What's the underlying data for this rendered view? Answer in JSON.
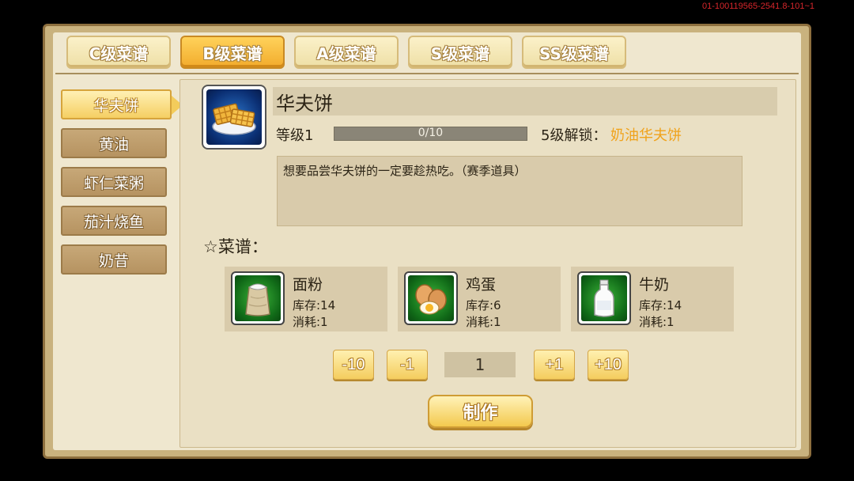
{
  "version": "01-100119565-2541.8-101~1",
  "tabs": [
    {
      "label": "C级菜谱",
      "active": false
    },
    {
      "label": "B级菜谱",
      "active": true
    },
    {
      "label": "A级菜谱",
      "active": false
    },
    {
      "label": "S级菜谱",
      "active": false
    },
    {
      "label": "SS级菜谱",
      "active": false
    }
  ],
  "sidebar": {
    "items": [
      {
        "label": "华夫饼",
        "active": true
      },
      {
        "label": "黄油",
        "active": false
      },
      {
        "label": "虾仁菜粥",
        "active": false
      },
      {
        "label": "茄汁烧鱼",
        "active": false
      },
      {
        "label": "奶昔",
        "active": false
      }
    ]
  },
  "item": {
    "icon": "waffle-icon",
    "name": "华夫饼",
    "level_label": "等级1",
    "progress_text": "0/10",
    "progress_current": 0,
    "progress_max": 10,
    "unlock_label": "5级解锁：",
    "unlock_value": "奶油华夫饼",
    "description": "想要品尝华夫饼的一定要趁热吃。（赛季道具）"
  },
  "recipe": {
    "label": "☆菜谱：",
    "ingredients": [
      {
        "name": "面粉",
        "icon": "flour-sack-icon",
        "stock": "库存:14",
        "cost": "消耗:1"
      },
      {
        "name": "鸡蛋",
        "icon": "eggs-icon",
        "stock": "库存:6",
        "cost": "消耗:1"
      },
      {
        "name": "牛奶",
        "icon": "milk-bottle-icon",
        "stock": "库存:14",
        "cost": "消耗:1"
      }
    ]
  },
  "quantity": {
    "minus10": "-10",
    "minus1": "-1",
    "value": "1",
    "plus1": "+1",
    "plus10": "+10"
  },
  "make_label": "制作",
  "colors": {
    "accent_gold": "#f3c94e",
    "unlock_orange": "#f0a21a",
    "ingredient_icon_green": "#3db53a",
    "item_icon_blue": "#2b74c9"
  }
}
